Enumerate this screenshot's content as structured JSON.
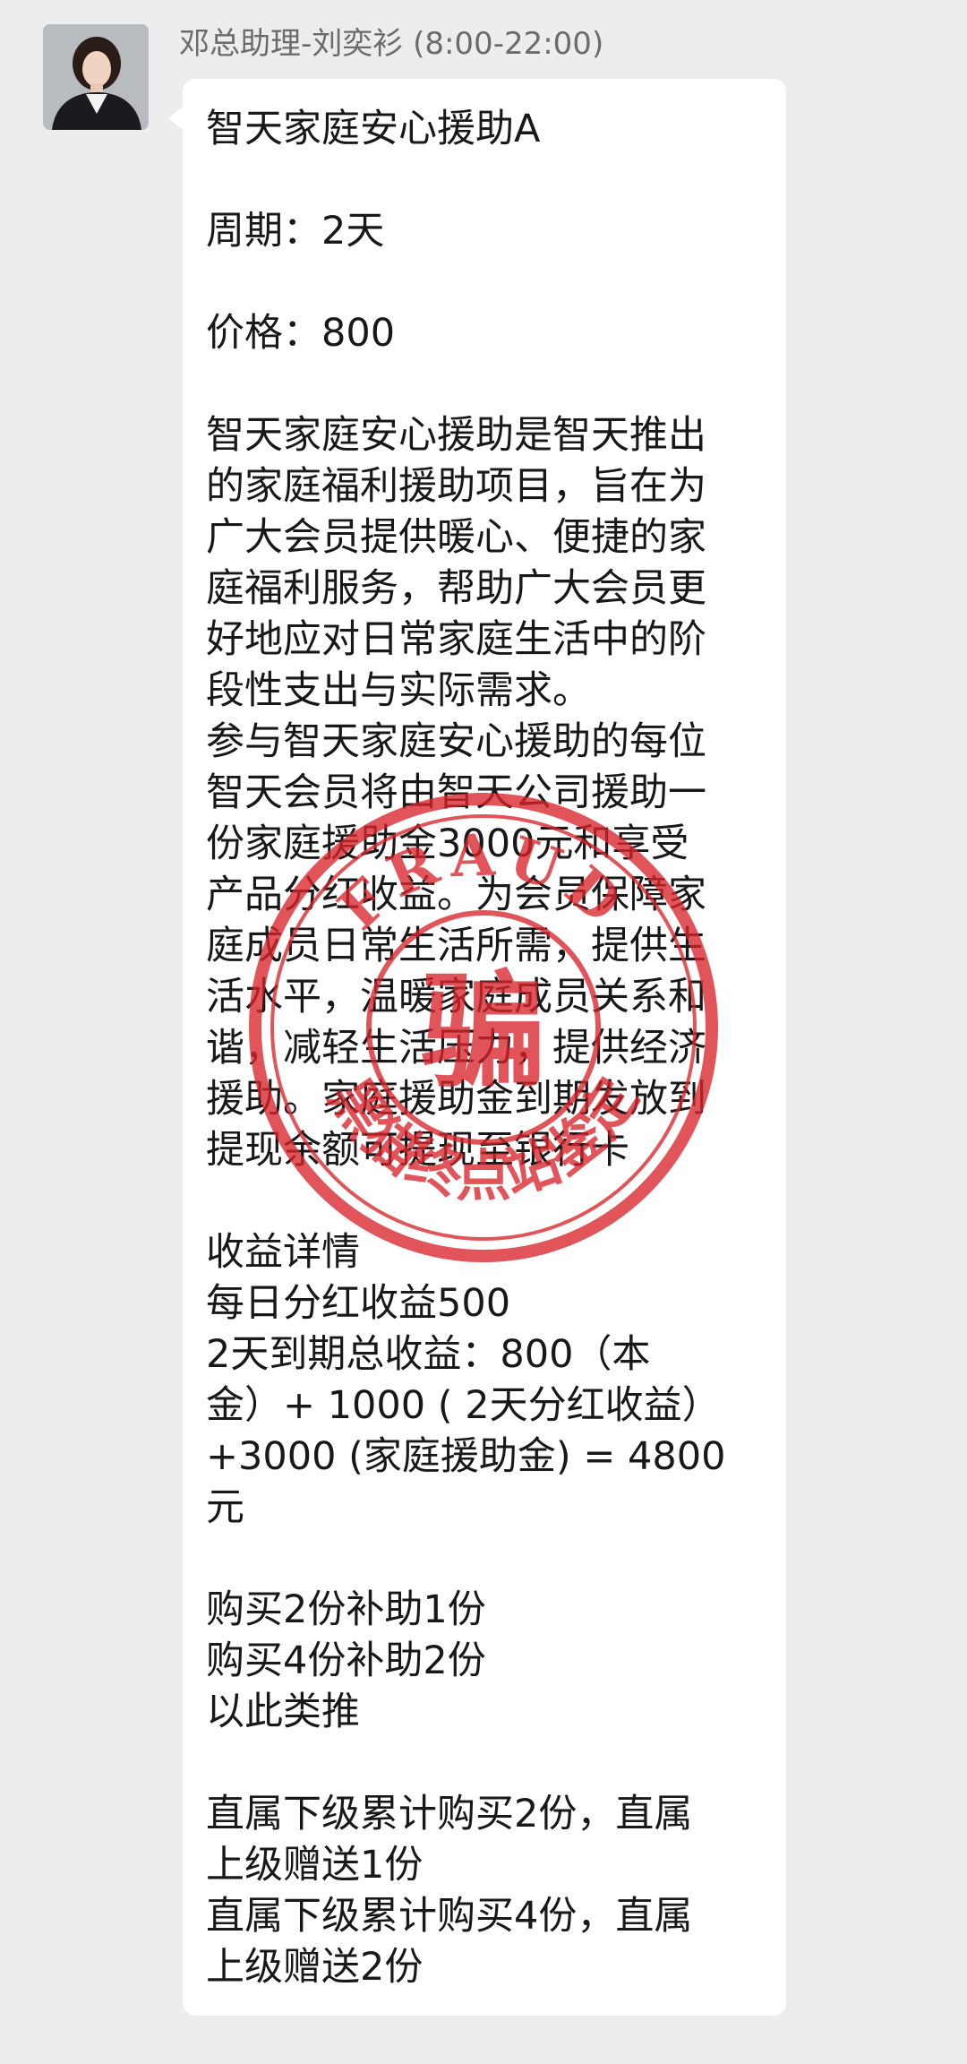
{
  "chat": {
    "sender_name": "邓总助理-刘奕衫 (8:00-22:00)",
    "message": {
      "title": "智天家庭安心援助A",
      "period": "周期：2天",
      "price": "价格：800",
      "description": [
        "智天家庭安心援助是智天推出",
        "的家庭福利援助项目，旨在为",
        "广大会员提供暖心、便捷的家",
        "庭福利服务，帮助广大会员更",
        "好地应对日常家庭生活中的阶",
        "段性支出与实际需求。",
        "参与智天家庭安心援助的每位",
        "智天会员将由智天公司援助一",
        "份家庭援助金3000元和享受",
        "产品分红收益。为会员保障家",
        "庭成员日常生活所需，提供生",
        "活水平，温暖家庭成员关系和",
        "谐，减轻生活压力，提供经济",
        "援助。家庭援助金到期发放到",
        "提现余额可提现至银行卡"
      ],
      "earnings": [
        "收益详情",
        "每日分红收益500",
        "2天到期总收益：800（本",
        "金）+ 1000 ( 2天分红收益）",
        "+3000 (家庭援助金) = 4800",
        "元"
      ],
      "bonus": [
        "购买2份补助1份",
        "购买4份补助2份",
        "以此类推"
      ],
      "referral": [
        "直属下级累计购买2份，直属",
        "上级赠送1份",
        "直属下级累计购买4份，直属",
        "上级赠送2份"
      ]
    }
  },
  "stamp": {
    "arc_text": "FRAUD",
    "center_char": "骗",
    "bottom_text": "黑猫终点站鉴定",
    "color": "#d9262c"
  },
  "colors": {
    "background": "#ededed",
    "bubble": "#ffffff",
    "text": "#181818",
    "name": "#6b6b6b"
  }
}
